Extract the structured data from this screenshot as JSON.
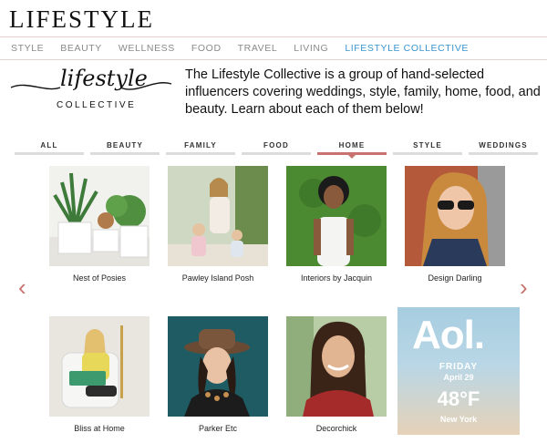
{
  "header": {
    "brand": "LIFESTYLE"
  },
  "nav": {
    "items": [
      "STYLE",
      "BEAUTY",
      "WELLNESS",
      "FOOD",
      "TRAVEL",
      "LIVING",
      "LIFESTYLE COLLECTIVE"
    ],
    "active": "LIFESTYLE COLLECTIVE",
    "active_color": "#3a95d0"
  },
  "logo": {
    "script": "lifestyle",
    "sub": "COLLECTIVE"
  },
  "intro": "The Lifestyle Collective is a group of hand-selected influencers covering weddings, style, family, home, food, and beauty. Learn about each of them below!",
  "tabs": {
    "items": [
      "ALL",
      "BEAUTY",
      "FAMILY",
      "FOOD",
      "HOME",
      "STYLE",
      "WEDDINGS"
    ],
    "active": "HOME",
    "accent_color": "#c9736f"
  },
  "influencers": [
    {
      "name": "Nest of Posies",
      "icon": "plants-photo"
    },
    {
      "name": "Pawley Island Posh",
      "icon": "family-photo"
    },
    {
      "name": "Interiors by Jacquin",
      "icon": "portrait-photo"
    },
    {
      "name": "Design Darling",
      "icon": "sunglasses-portrait-photo"
    },
    {
      "name": "Bliss at Home",
      "icon": "reading-chair-photo"
    },
    {
      "name": "Parker Etc",
      "icon": "hat-portrait-photo"
    },
    {
      "name": "Decorchick",
      "icon": "smiling-portrait-photo"
    }
  ],
  "arrows": {
    "prev": "‹",
    "next": "›"
  },
  "ad": {
    "brand": "Aol.",
    "day": "FRIDAY",
    "date": "April 29",
    "temp": "48°F",
    "city": "New York"
  }
}
